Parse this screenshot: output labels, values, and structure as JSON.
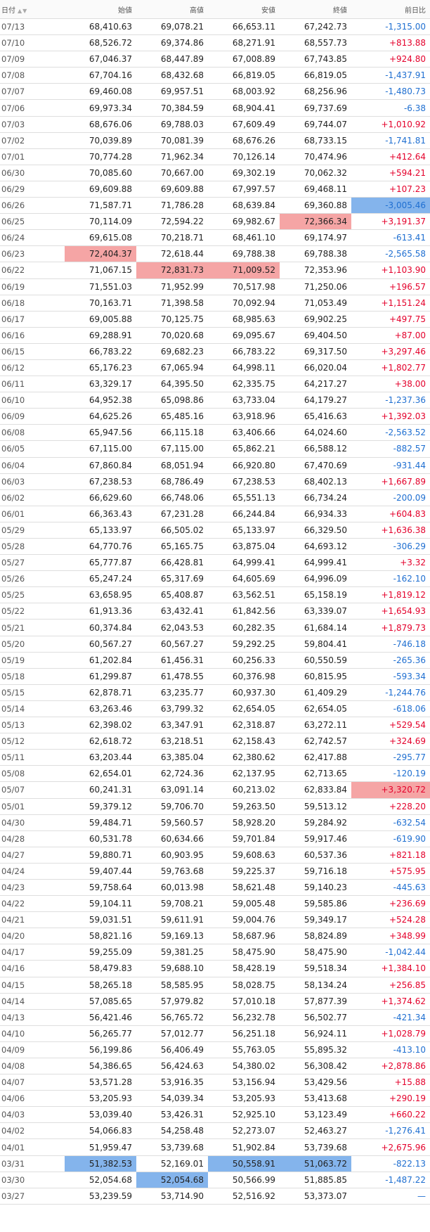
{
  "header": {
    "date": "日付",
    "open": "始値",
    "high": "高値",
    "low": "安値",
    "close": "終値",
    "change": "前日比",
    "sort_up_icon": "▲",
    "sort_down_icon": "▼"
  },
  "colors": {
    "positive": "#e4002b",
    "negative": "#1f6fd1",
    "highlight_max": "#f5a5a5",
    "highlight_min": "#84b4ec"
  },
  "rows": [
    {
      "date": "07/13",
      "open": "68,410.63",
      "high": "69,078.21",
      "low": "66,653.11",
      "close": "67,242.73",
      "change": "-1,315.00"
    },
    {
      "date": "07/10",
      "open": "68,526.72",
      "high": "69,374.86",
      "low": "68,271.91",
      "close": "68,557.73",
      "change": "+813.88"
    },
    {
      "date": "07/09",
      "open": "67,046.37",
      "high": "68,447.89",
      "low": "67,008.89",
      "close": "67,743.85",
      "change": "+924.80"
    },
    {
      "date": "07/08",
      "open": "67,704.16",
      "high": "68,432.68",
      "low": "66,819.05",
      "close": "66,819.05",
      "change": "-1,437.91"
    },
    {
      "date": "07/07",
      "open": "69,460.08",
      "high": "69,957.51",
      "low": "68,003.92",
      "close": "68,256.96",
      "change": "-1,480.73"
    },
    {
      "date": "07/06",
      "open": "69,973.34",
      "high": "70,384.59",
      "low": "68,904.41",
      "close": "69,737.69",
      "change": "-6.38"
    },
    {
      "date": "07/03",
      "open": "68,676.06",
      "high": "69,788.03",
      "low": "67,609.49",
      "close": "69,744.07",
      "change": "+1,010.92"
    },
    {
      "date": "07/02",
      "open": "70,039.89",
      "high": "70,081.39",
      "low": "68,676.26",
      "close": "68,733.15",
      "change": "-1,741.81"
    },
    {
      "date": "07/01",
      "open": "70,774.28",
      "high": "71,962.34",
      "low": "70,126.14",
      "close": "70,474.96",
      "change": "+412.64"
    },
    {
      "date": "06/30",
      "open": "70,085.60",
      "high": "70,667.00",
      "low": "69,302.19",
      "close": "70,062.32",
      "change": "+594.21"
    },
    {
      "date": "06/29",
      "open": "69,609.88",
      "high": "69,609.88",
      "low": "67,997.57",
      "close": "69,468.11",
      "change": "+107.23"
    },
    {
      "date": "06/26",
      "open": "71,587.71",
      "high": "71,786.28",
      "low": "68,639.84",
      "close": "69,360.88",
      "change": "-3,005.46",
      "hl": {
        "change": "min"
      }
    },
    {
      "date": "06/25",
      "open": "70,114.09",
      "high": "72,594.22",
      "low": "69,982.67",
      "close": "72,366.34",
      "change": "+3,191.37",
      "hl": {
        "close": "max"
      }
    },
    {
      "date": "06/24",
      "open": "69,615.08",
      "high": "70,218.71",
      "low": "68,461.10",
      "close": "69,174.97",
      "change": "-613.41"
    },
    {
      "date": "06/23",
      "open": "72,404.37",
      "high": "72,618.44",
      "low": "69,788.38",
      "close": "69,788.38",
      "change": "-2,565.58",
      "hl": {
        "open": "max"
      }
    },
    {
      "date": "06/22",
      "open": "71,067.15",
      "high": "72,831.73",
      "low": "71,009.52",
      "close": "72,353.96",
      "change": "+1,103.90",
      "hl": {
        "high": "max",
        "low": "max"
      }
    },
    {
      "date": "06/19",
      "open": "71,551.03",
      "high": "71,952.99",
      "low": "70,517.98",
      "close": "71,250.06",
      "change": "+196.57"
    },
    {
      "date": "06/18",
      "open": "70,163.71",
      "high": "71,398.58",
      "low": "70,092.94",
      "close": "71,053.49",
      "change": "+1,151.24"
    },
    {
      "date": "06/17",
      "open": "69,005.88",
      "high": "70,125.75",
      "low": "68,985.63",
      "close": "69,902.25",
      "change": "+497.75"
    },
    {
      "date": "06/16",
      "open": "69,288.91",
      "high": "70,020.68",
      "low": "69,095.67",
      "close": "69,404.50",
      "change": "+87.00"
    },
    {
      "date": "06/15",
      "open": "66,783.22",
      "high": "69,682.23",
      "low": "66,783.22",
      "close": "69,317.50",
      "change": "+3,297.46"
    },
    {
      "date": "06/12",
      "open": "65,176.23",
      "high": "67,065.94",
      "low": "64,998.11",
      "close": "66,020.04",
      "change": "+1,802.77"
    },
    {
      "date": "06/11",
      "open": "63,329.17",
      "high": "64,395.50",
      "low": "62,335.75",
      "close": "64,217.27",
      "change": "+38.00"
    },
    {
      "date": "06/10",
      "open": "64,952.38",
      "high": "65,098.86",
      "low": "63,733.04",
      "close": "64,179.27",
      "change": "-1,237.36"
    },
    {
      "date": "06/09",
      "open": "64,625.26",
      "high": "65,485.16",
      "low": "63,918.96",
      "close": "65,416.63",
      "change": "+1,392.03"
    },
    {
      "date": "06/08",
      "open": "65,947.56",
      "high": "66,115.18",
      "low": "63,406.66",
      "close": "64,024.60",
      "change": "-2,563.52"
    },
    {
      "date": "06/05",
      "open": "67,115.00",
      "high": "67,115.00",
      "low": "65,862.21",
      "close": "66,588.12",
      "change": "-882.57"
    },
    {
      "date": "06/04",
      "open": "67,860.84",
      "high": "68,051.94",
      "low": "66,920.80",
      "close": "67,470.69",
      "change": "-931.44"
    },
    {
      "date": "06/03",
      "open": "67,238.53",
      "high": "68,786.49",
      "low": "67,238.53",
      "close": "68,402.13",
      "change": "+1,667.89"
    },
    {
      "date": "06/02",
      "open": "66,629.60",
      "high": "66,748.06",
      "low": "65,551.13",
      "close": "66,734.24",
      "change": "-200.09"
    },
    {
      "date": "06/01",
      "open": "66,363.43",
      "high": "67,231.28",
      "low": "66,244.84",
      "close": "66,934.33",
      "change": "+604.83"
    },
    {
      "date": "05/29",
      "open": "65,133.97",
      "high": "66,505.02",
      "low": "65,133.97",
      "close": "66,329.50",
      "change": "+1,636.38"
    },
    {
      "date": "05/28",
      "open": "64,770.76",
      "high": "65,165.75",
      "low": "63,875.04",
      "close": "64,693.12",
      "change": "-306.29"
    },
    {
      "date": "05/27",
      "open": "65,777.87",
      "high": "66,428.81",
      "low": "64,999.41",
      "close": "64,999.41",
      "change": "+3.32"
    },
    {
      "date": "05/26",
      "open": "65,247.24",
      "high": "65,317.69",
      "low": "64,605.69",
      "close": "64,996.09",
      "change": "-162.10"
    },
    {
      "date": "05/25",
      "open": "63,658.95",
      "high": "65,408.87",
      "low": "63,562.51",
      "close": "65,158.19",
      "change": "+1,819.12"
    },
    {
      "date": "05/22",
      "open": "61,913.36",
      "high": "63,432.41",
      "low": "61,842.56",
      "close": "63,339.07",
      "change": "+1,654.93"
    },
    {
      "date": "05/21",
      "open": "60,374.84",
      "high": "62,043.53",
      "low": "60,282.35",
      "close": "61,684.14",
      "change": "+1,879.73"
    },
    {
      "date": "05/20",
      "open": "60,567.27",
      "high": "60,567.27",
      "low": "59,292.25",
      "close": "59,804.41",
      "change": "-746.18"
    },
    {
      "date": "05/19",
      "open": "61,202.84",
      "high": "61,456.31",
      "low": "60,256.33",
      "close": "60,550.59",
      "change": "-265.36"
    },
    {
      "date": "05/18",
      "open": "61,299.87",
      "high": "61,478.55",
      "low": "60,376.98",
      "close": "60,815.95",
      "change": "-593.34"
    },
    {
      "date": "05/15",
      "open": "62,878.71",
      "high": "63,235.77",
      "low": "60,937.30",
      "close": "61,409.29",
      "change": "-1,244.76"
    },
    {
      "date": "05/14",
      "open": "63,263.46",
      "high": "63,799.32",
      "low": "62,654.05",
      "close": "62,654.05",
      "change": "-618.06"
    },
    {
      "date": "05/13",
      "open": "62,398.02",
      "high": "63,347.91",
      "low": "62,318.87",
      "close": "63,272.11",
      "change": "+529.54"
    },
    {
      "date": "05/12",
      "open": "62,618.72",
      "high": "63,218.51",
      "low": "62,158.43",
      "close": "62,742.57",
      "change": "+324.69"
    },
    {
      "date": "05/11",
      "open": "63,203.44",
      "high": "63,385.04",
      "low": "62,380.62",
      "close": "62,417.88",
      "change": "-295.77"
    },
    {
      "date": "05/08",
      "open": "62,654.01",
      "high": "62,724.36",
      "low": "62,137.95",
      "close": "62,713.65",
      "change": "-120.19"
    },
    {
      "date": "05/07",
      "open": "60,241.31",
      "high": "63,091.14",
      "low": "60,213.02",
      "close": "62,833.84",
      "change": "+3,320.72",
      "hl": {
        "change": "max"
      }
    },
    {
      "date": "05/01",
      "open": "59,379.12",
      "high": "59,706.70",
      "low": "59,263.50",
      "close": "59,513.12",
      "change": "+228.20"
    },
    {
      "date": "04/30",
      "open": "59,484.71",
      "high": "59,560.57",
      "low": "58,928.20",
      "close": "59,284.92",
      "change": "-632.54"
    },
    {
      "date": "04/28",
      "open": "60,531.78",
      "high": "60,634.66",
      "low": "59,701.84",
      "close": "59,917.46",
      "change": "-619.90"
    },
    {
      "date": "04/27",
      "open": "59,880.71",
      "high": "60,903.95",
      "low": "59,608.63",
      "close": "60,537.36",
      "change": "+821.18"
    },
    {
      "date": "04/24",
      "open": "59,407.44",
      "high": "59,763.68",
      "low": "59,225.37",
      "close": "59,716.18",
      "change": "+575.95"
    },
    {
      "date": "04/23",
      "open": "59,758.64",
      "high": "60,013.98",
      "low": "58,621.48",
      "close": "59,140.23",
      "change": "-445.63"
    },
    {
      "date": "04/22",
      "open": "59,104.11",
      "high": "59,708.21",
      "low": "59,005.48",
      "close": "59,585.86",
      "change": "+236.69"
    },
    {
      "date": "04/21",
      "open": "59,031.51",
      "high": "59,611.91",
      "low": "59,004.76",
      "close": "59,349.17",
      "change": "+524.28"
    },
    {
      "date": "04/20",
      "open": "58,821.16",
      "high": "59,169.13",
      "low": "58,687.96",
      "close": "58,824.89",
      "change": "+348.99"
    },
    {
      "date": "04/17",
      "open": "59,255.09",
      "high": "59,381.25",
      "low": "58,475.90",
      "close": "58,475.90",
      "change": "-1,042.44"
    },
    {
      "date": "04/16",
      "open": "58,479.83",
      "high": "59,688.10",
      "low": "58,428.19",
      "close": "59,518.34",
      "change": "+1,384.10"
    },
    {
      "date": "04/15",
      "open": "58,265.18",
      "high": "58,585.95",
      "low": "58,028.75",
      "close": "58,134.24",
      "change": "+256.85"
    },
    {
      "date": "04/14",
      "open": "57,085.65",
      "high": "57,979.82",
      "low": "57,010.18",
      "close": "57,877.39",
      "change": "+1,374.62"
    },
    {
      "date": "04/13",
      "open": "56,421.46",
      "high": "56,765.72",
      "low": "56,232.78",
      "close": "56,502.77",
      "change": "-421.34"
    },
    {
      "date": "04/10",
      "open": "56,265.77",
      "high": "57,012.77",
      "low": "56,251.18",
      "close": "56,924.11",
      "change": "+1,028.79"
    },
    {
      "date": "04/09",
      "open": "56,199.86",
      "high": "56,406.49",
      "low": "55,763.05",
      "close": "55,895.32",
      "change": "-413.10"
    },
    {
      "date": "04/08",
      "open": "54,386.65",
      "high": "56,424.63",
      "low": "54,380.02",
      "close": "56,308.42",
      "change": "+2,878.86"
    },
    {
      "date": "04/07",
      "open": "53,571.28",
      "high": "53,916.35",
      "low": "53,156.94",
      "close": "53,429.56",
      "change": "+15.88"
    },
    {
      "date": "04/06",
      "open": "53,205.93",
      "high": "54,039.34",
      "low": "53,205.93",
      "close": "53,413.68",
      "change": "+290.19"
    },
    {
      "date": "04/03",
      "open": "53,039.40",
      "high": "53,426.31",
      "low": "52,925.10",
      "close": "53,123.49",
      "change": "+660.22"
    },
    {
      "date": "04/02",
      "open": "54,066.83",
      "high": "54,258.48",
      "low": "52,273.07",
      "close": "52,463.27",
      "change": "-1,276.41"
    },
    {
      "date": "04/01",
      "open": "51,959.47",
      "high": "53,739.68",
      "low": "51,902.84",
      "close": "53,739.68",
      "change": "+2,675.96"
    },
    {
      "date": "03/31",
      "open": "51,382.53",
      "high": "52,169.01",
      "low": "50,558.91",
      "close": "51,063.72",
      "change": "-822.13",
      "hl": {
        "open": "min",
        "low": "min",
        "close": "min"
      }
    },
    {
      "date": "03/30",
      "open": "52,054.68",
      "high": "52,054.68",
      "low": "50,566.99",
      "close": "51,885.85",
      "change": "-1,487.22",
      "hl": {
        "high": "min"
      }
    },
    {
      "date": "03/27",
      "open": "53,239.59",
      "high": "53,714.90",
      "low": "52,516.92",
      "close": "53,373.07",
      "change": "—"
    }
  ]
}
